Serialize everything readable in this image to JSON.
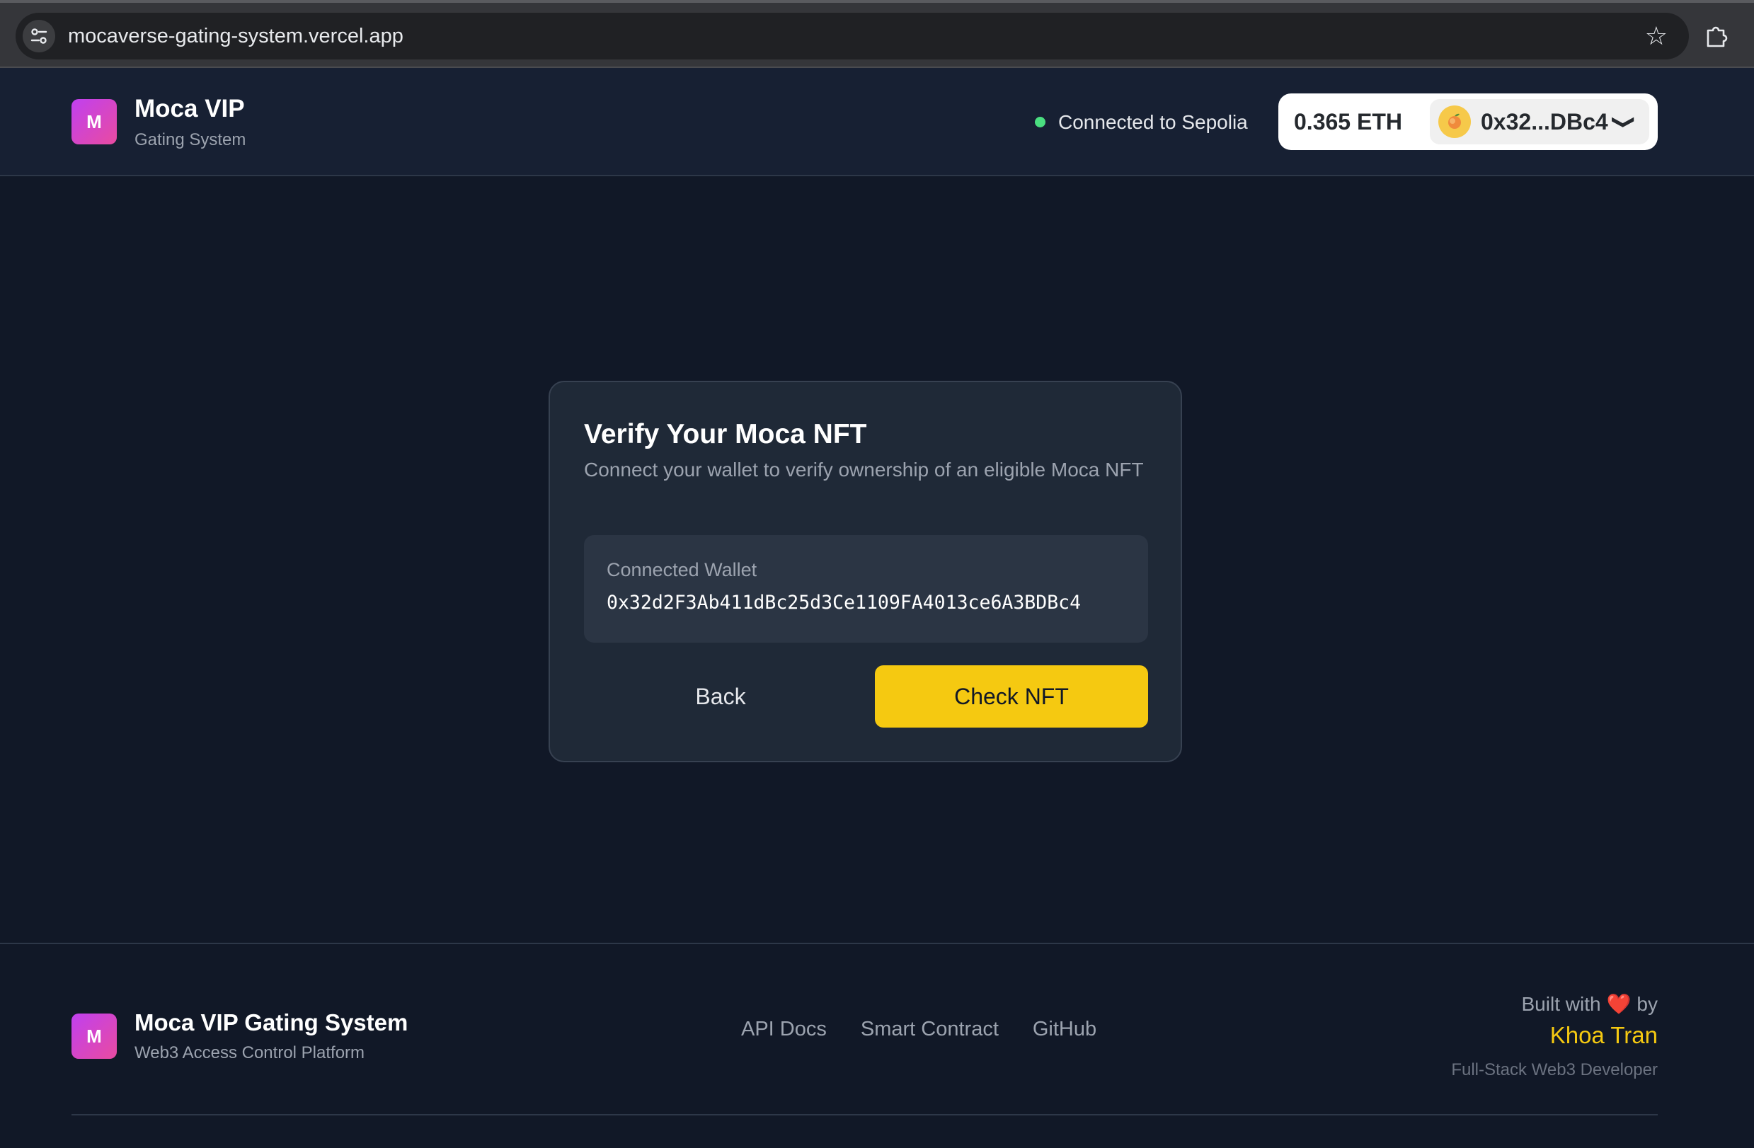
{
  "browser": {
    "url": "mocaverse-gating-system.vercel.app",
    "site_info_icon": "tune-icon",
    "bookmark_icon": "star-icon",
    "extensions_icon": "puzzle-icon"
  },
  "header": {
    "logo_letter": "M",
    "title": "Moca VIP",
    "subtitle": "Gating System",
    "network_status": "Connected to Sepolia",
    "status_color": "#4ade80",
    "eth_balance": "0.365 ETH",
    "account": "0x32...DBc4",
    "chevron": "❯"
  },
  "card": {
    "title": "Verify Your Moca NFT",
    "description": "Connect your wallet to verify ownership of an eligible Moca NFT",
    "wallet_label": "Connected Wallet",
    "wallet_address": "0x32d2F3Ab411dBc25d3Ce1109FA4013ce6A3BDBc4",
    "back_label": "Back",
    "check_label": "Check NFT",
    "accent_color": "#f5c911"
  },
  "footer": {
    "logo_letter": "M",
    "title": "Moca VIP Gating System",
    "subtitle": "Web3 Access Control Platform",
    "links": [
      "API Docs",
      "Smart Contract",
      "GitHub"
    ],
    "built_with_prefix": "Built with",
    "built_with_suffix": "by",
    "heart": "❤️",
    "author": "Khoa Tran",
    "author_role": "Full-Stack Web3 Developer"
  }
}
